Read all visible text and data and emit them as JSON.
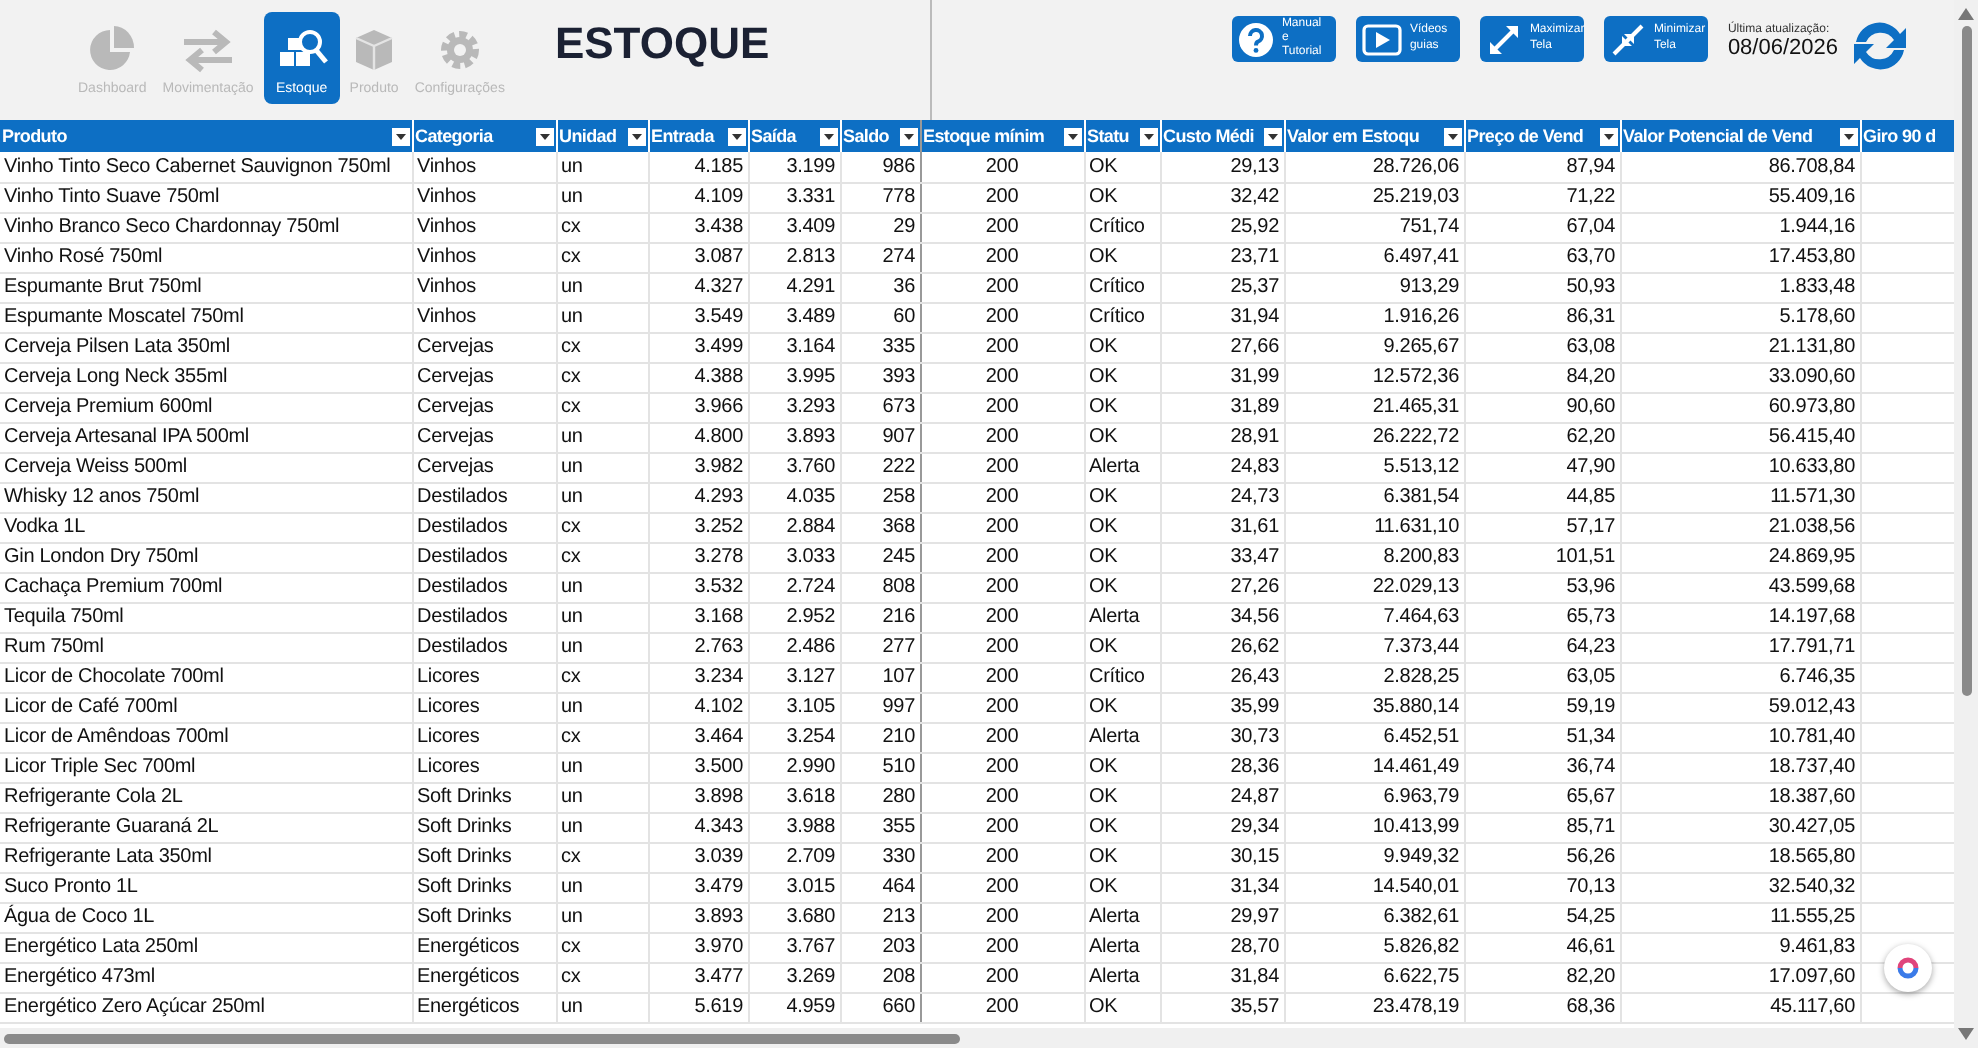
{
  "nav": [
    {
      "label": "Dashboard",
      "selected": false
    },
    {
      "label": "Movimentação",
      "selected": false
    },
    {
      "label": "Estoque",
      "selected": true
    },
    {
      "label": "Produto",
      "selected": false
    },
    {
      "label": "Configurações",
      "selected": false
    }
  ],
  "title": "ESTOQUE",
  "actions": [
    {
      "label": "Manual e Tutorial"
    },
    {
      "label": "Vídeos guias"
    },
    {
      "label": "Maximizar Tela"
    },
    {
      "label": "Minimizar Tela"
    }
  ],
  "last_update": {
    "label": "Última atualização:",
    "value": "08/06/2026"
  },
  "table": {
    "columns": [
      "Produto",
      "Categoria",
      "Unidad",
      "Entrada",
      "Saída",
      "Saldo",
      "Estoque mínim",
      "Statu",
      "Custo Médi",
      "Valor em Estoqu",
      "Preço de Vend",
      "Valor Potencial de Vend",
      "Giro 90 d"
    ],
    "rows": [
      [
        "Vinho Tinto Seco Cabernet Sauvignon 750ml",
        "Vinhos",
        "un",
        "4.185",
        "3.199",
        "986",
        "200",
        "OK",
        "29,13",
        "28.726,06",
        "87,94",
        "86.708,84"
      ],
      [
        "Vinho Tinto Suave 750ml",
        "Vinhos",
        "un",
        "4.109",
        "3.331",
        "778",
        "200",
        "OK",
        "32,42",
        "25.219,03",
        "71,22",
        "55.409,16"
      ],
      [
        "Vinho Branco Seco Chardonnay 750ml",
        "Vinhos",
        "cx",
        "3.438",
        "3.409",
        "29",
        "200",
        "Crítico",
        "25,92",
        "751,74",
        "67,04",
        "1.944,16"
      ],
      [
        "Vinho Rosé 750ml",
        "Vinhos",
        "cx",
        "3.087",
        "2.813",
        "274",
        "200",
        "OK",
        "23,71",
        "6.497,41",
        "63,70",
        "17.453,80"
      ],
      [
        "Espumante Brut 750ml",
        "Vinhos",
        "un",
        "4.327",
        "4.291",
        "36",
        "200",
        "Crítico",
        "25,37",
        "913,29",
        "50,93",
        "1.833,48"
      ],
      [
        "Espumante Moscatel 750ml",
        "Vinhos",
        "un",
        "3.549",
        "3.489",
        "60",
        "200",
        "Crítico",
        "31,94",
        "1.916,26",
        "86,31",
        "5.178,60"
      ],
      [
        "Cerveja Pilsen Lata 350ml",
        "Cervejas",
        "cx",
        "3.499",
        "3.164",
        "335",
        "200",
        "OK",
        "27,66",
        "9.265,67",
        "63,08",
        "21.131,80"
      ],
      [
        "Cerveja Long Neck 355ml",
        "Cervejas",
        "cx",
        "4.388",
        "3.995",
        "393",
        "200",
        "OK",
        "31,99",
        "12.572,36",
        "84,20",
        "33.090,60"
      ],
      [
        "Cerveja Premium 600ml",
        "Cervejas",
        "cx",
        "3.966",
        "3.293",
        "673",
        "200",
        "OK",
        "31,89",
        "21.465,31",
        "90,60",
        "60.973,80"
      ],
      [
        "Cerveja Artesanal IPA 500ml",
        "Cervejas",
        "un",
        "4.800",
        "3.893",
        "907",
        "200",
        "OK",
        "28,91",
        "26.222,72",
        "62,20",
        "56.415,40"
      ],
      [
        "Cerveja Weiss 500ml",
        "Cervejas",
        "un",
        "3.982",
        "3.760",
        "222",
        "200",
        "Alerta",
        "24,83",
        "5.513,12",
        "47,90",
        "10.633,80"
      ],
      [
        "Whisky 12 anos 750ml",
        "Destilados",
        "un",
        "4.293",
        "4.035",
        "258",
        "200",
        "OK",
        "24,73",
        "6.381,54",
        "44,85",
        "11.571,30"
      ],
      [
        "Vodka 1L",
        "Destilados",
        "cx",
        "3.252",
        "2.884",
        "368",
        "200",
        "OK",
        "31,61",
        "11.631,10",
        "57,17",
        "21.038,56"
      ],
      [
        "Gin London Dry 750ml",
        "Destilados",
        "cx",
        "3.278",
        "3.033",
        "245",
        "200",
        "OK",
        "33,47",
        "8.200,83",
        "101,51",
        "24.869,95"
      ],
      [
        "Cachaça Premium 700ml",
        "Destilados",
        "un",
        "3.532",
        "2.724",
        "808",
        "200",
        "OK",
        "27,26",
        "22.029,13",
        "53,96",
        "43.599,68"
      ],
      [
        "Tequila 750ml",
        "Destilados",
        "un",
        "3.168",
        "2.952",
        "216",
        "200",
        "Alerta",
        "34,56",
        "7.464,63",
        "65,73",
        "14.197,68"
      ],
      [
        "Rum 750ml",
        "Destilados",
        "un",
        "2.763",
        "2.486",
        "277",
        "200",
        "OK",
        "26,62",
        "7.373,44",
        "64,23",
        "17.791,71"
      ],
      [
        "Licor de Chocolate 700ml",
        "Licores",
        "cx",
        "3.234",
        "3.127",
        "107",
        "200",
        "Crítico",
        "26,43",
        "2.828,25",
        "63,05",
        "6.746,35"
      ],
      [
        "Licor de Café 700ml",
        "Licores",
        "un",
        "4.102",
        "3.105",
        "997",
        "200",
        "OK",
        "35,99",
        "35.880,14",
        "59,19",
        "59.012,43"
      ],
      [
        "Licor de Amêndoas 700ml",
        "Licores",
        "cx",
        "3.464",
        "3.254",
        "210",
        "200",
        "Alerta",
        "30,73",
        "6.452,51",
        "51,34",
        "10.781,40"
      ],
      [
        "Licor Triple Sec 700ml",
        "Licores",
        "un",
        "3.500",
        "2.990",
        "510",
        "200",
        "OK",
        "28,36",
        "14.461,49",
        "36,74",
        "18.737,40"
      ],
      [
        "Refrigerante Cola 2L",
        "Soft Drinks",
        "un",
        "3.898",
        "3.618",
        "280",
        "200",
        "OK",
        "24,87",
        "6.963,79",
        "65,67",
        "18.387,60"
      ],
      [
        "Refrigerante Guaraná 2L",
        "Soft Drinks",
        "un",
        "4.343",
        "3.988",
        "355",
        "200",
        "OK",
        "29,34",
        "10.413,99",
        "85,71",
        "30.427,05"
      ],
      [
        "Refrigerante Lata 350ml",
        "Soft Drinks",
        "cx",
        "3.039",
        "2.709",
        "330",
        "200",
        "OK",
        "30,15",
        "9.949,32",
        "56,26",
        "18.565,80"
      ],
      [
        "Suco Pronto 1L",
        "Soft Drinks",
        "un",
        "3.479",
        "3.015",
        "464",
        "200",
        "OK",
        "31,34",
        "14.540,01",
        "70,13",
        "32.540,32"
      ],
      [
        "Água de Coco 1L",
        "Soft Drinks",
        "un",
        "3.893",
        "3.680",
        "213",
        "200",
        "Alerta",
        "29,97",
        "6.382,61",
        "54,25",
        "11.555,25"
      ],
      [
        "Energético Lata 250ml",
        "Energéticos",
        "cx",
        "3.970",
        "3.767",
        "203",
        "200",
        "Alerta",
        "28,70",
        "5.826,82",
        "46,61",
        "9.461,83"
      ],
      [
        "Energético 473ml",
        "Energéticos",
        "cx",
        "3.477",
        "3.269",
        "208",
        "200",
        "Alerta",
        "31,84",
        "6.622,75",
        "82,20",
        "17.097,60"
      ],
      [
        "Energético Zero Açúcar 250ml",
        "Energéticos",
        "un",
        "5.619",
        "4.959",
        "660",
        "200",
        "OK",
        "35,57",
        "23.478,19",
        "68,36",
        "45.117,60"
      ]
    ]
  }
}
